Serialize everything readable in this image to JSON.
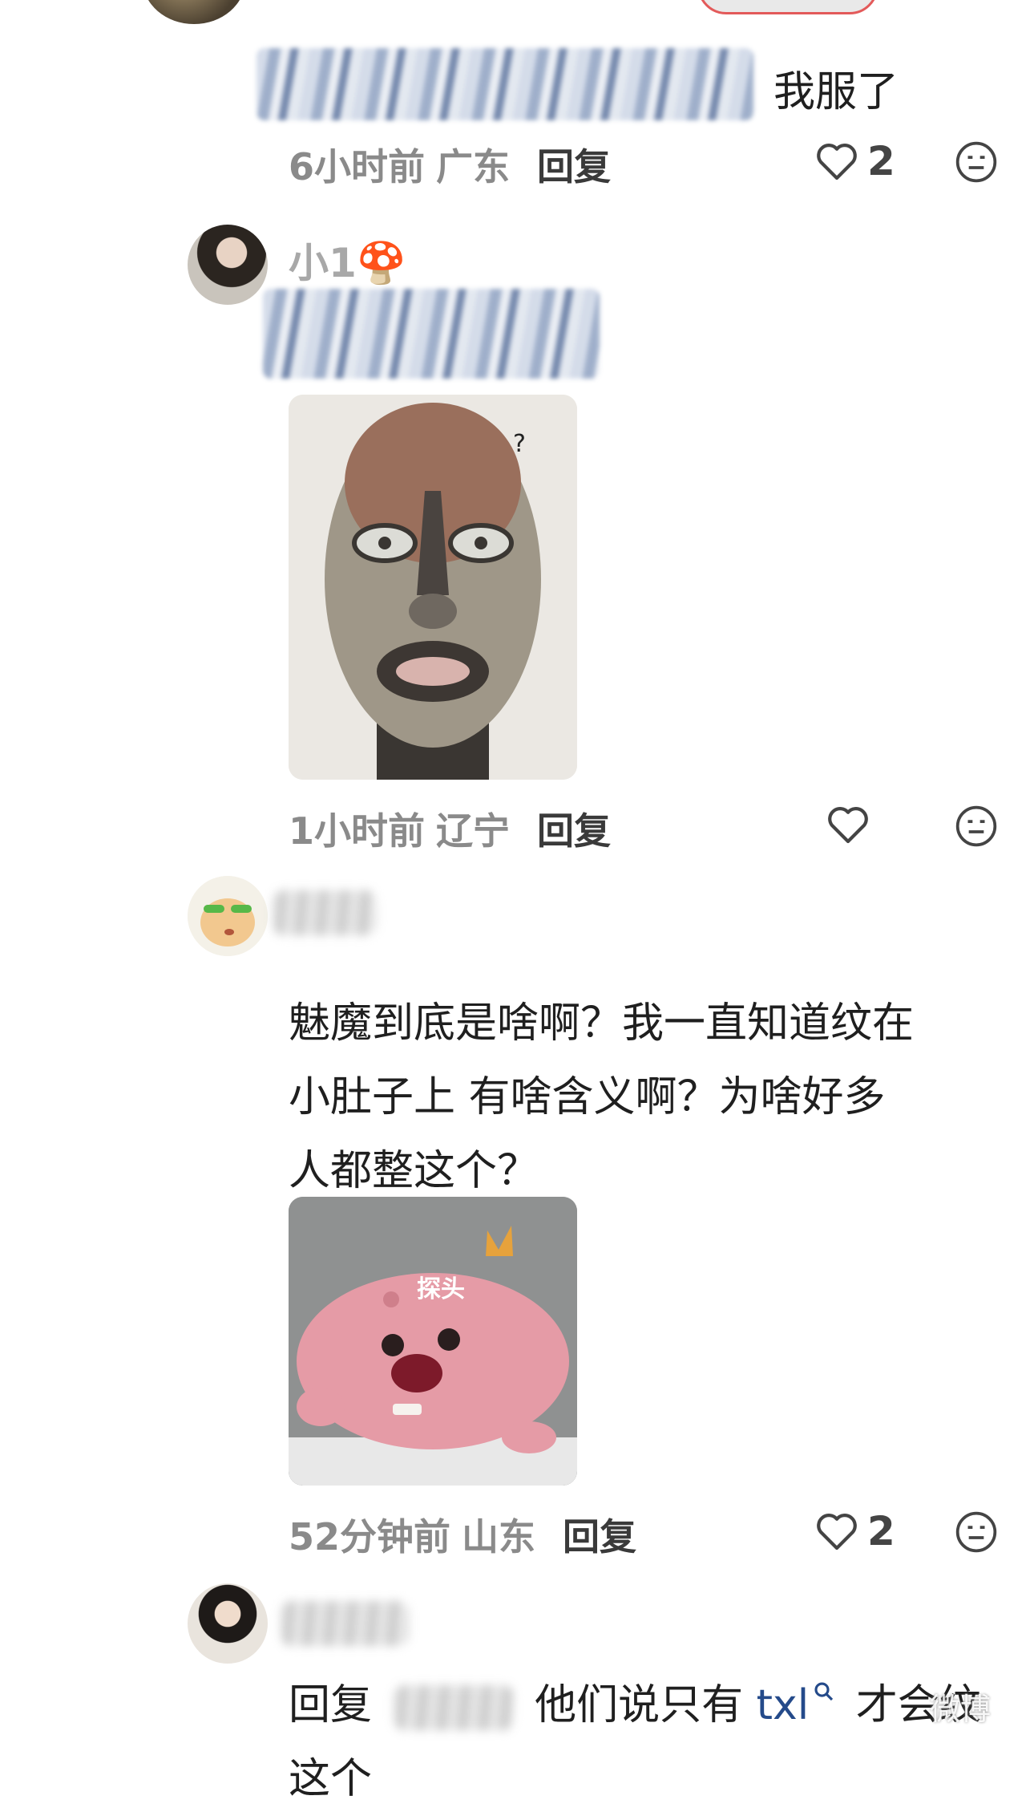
{
  "comments": [
    {
      "text_suffix": "我服了",
      "time": "6小时前",
      "region": "广东",
      "reply_label": "回复",
      "likes": "2"
    },
    {
      "username": "小1🍄",
      "image_mark": "?",
      "time": "1小时前",
      "region": "辽宁",
      "reply_label": "回复",
      "likes": ""
    },
    {
      "lines": [
        "魅魔到底是啥啊？我一直知道纹在",
        "小肚子上  有啥含义啊？为啥好多",
        "人都整这个？"
      ],
      "sticker_caption": "探头",
      "time": "52分钟前",
      "region": "山东",
      "reply_label": "回复",
      "likes": "2"
    },
    {
      "reply_prefix": "回复",
      "text_a": "他们说只有",
      "link_text": "txl",
      "text_b": "才会纹",
      "overflow_text": "这个"
    }
  ],
  "watermark": "微博"
}
